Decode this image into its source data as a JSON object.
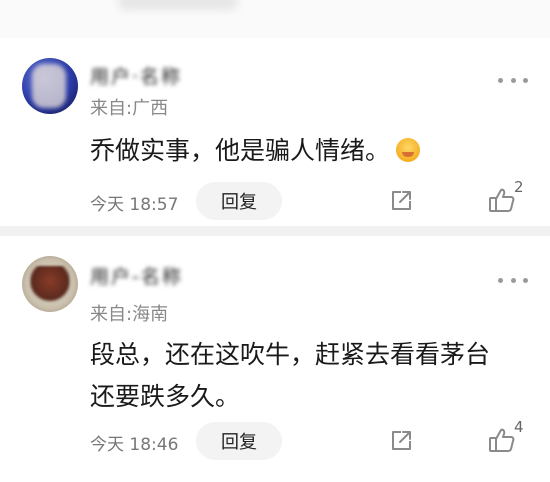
{
  "comments": [
    {
      "username": "用户·名称",
      "location": "来自:广西",
      "content": "乔做实事，他是骗人情绪。",
      "emoji_icon": "sleepy-face-emoji",
      "time": "今天 18:57",
      "reply_label": "回复",
      "likes": "2"
    },
    {
      "username": "用户-名称",
      "location": "来自:海南",
      "content": "段总，还在这吹牛，赶紧去看看茅台还要跌多久。",
      "time": "今天 18:46",
      "reply_label": "回复",
      "likes": "4"
    }
  ],
  "icons": {
    "more": "more-dots-icon",
    "share": "share-icon",
    "like": "thumbs-up-icon"
  },
  "colors": {
    "text": "#1a1a1a",
    "muted": "#888888",
    "button_bg": "#f3f3f3",
    "icon": "#8a8a8a"
  }
}
